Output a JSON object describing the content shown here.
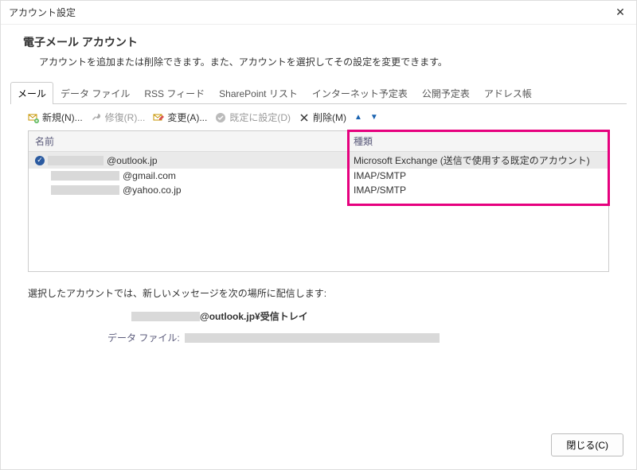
{
  "titlebar": {
    "title": "アカウント設定",
    "close": "✕"
  },
  "header": {
    "heading": "電子メール アカウント",
    "description": "アカウントを追加または削除できます。また、アカウントを選択してその設定を変更できます。"
  },
  "tabs": [
    {
      "label": "メール",
      "active": true
    },
    {
      "label": "データ ファイル"
    },
    {
      "label": "RSS フィード"
    },
    {
      "label": "SharePoint リスト"
    },
    {
      "label": "インターネット予定表"
    },
    {
      "label": "公開予定表"
    },
    {
      "label": "アドレス帳"
    }
  ],
  "toolbar": {
    "new": "新規(N)...",
    "repair": "修復(R)...",
    "change": "変更(A)...",
    "setDefault": "既定に設定(D)",
    "remove": "削除(M)"
  },
  "table": {
    "columns": {
      "name": "名前",
      "type": "種類"
    },
    "rows": [
      {
        "domain": "@outlook.jp",
        "type": "Microsoft Exchange (送信で使用する既定のアカウント)",
        "default": true,
        "selected": true
      },
      {
        "domain": "@gmail.com",
        "type": "IMAP/SMTP"
      },
      {
        "domain": "@yahoo.co.jp",
        "type": "IMAP/SMTP"
      }
    ]
  },
  "delivery": {
    "message": "選択したアカウントでは、新しいメッセージを次の場所に配信します:",
    "locationSuffix": "@outlook.jp¥受信トレイ",
    "datafileLabel": "データ ファイル:"
  },
  "footer": {
    "close": "閉じる(C)"
  }
}
